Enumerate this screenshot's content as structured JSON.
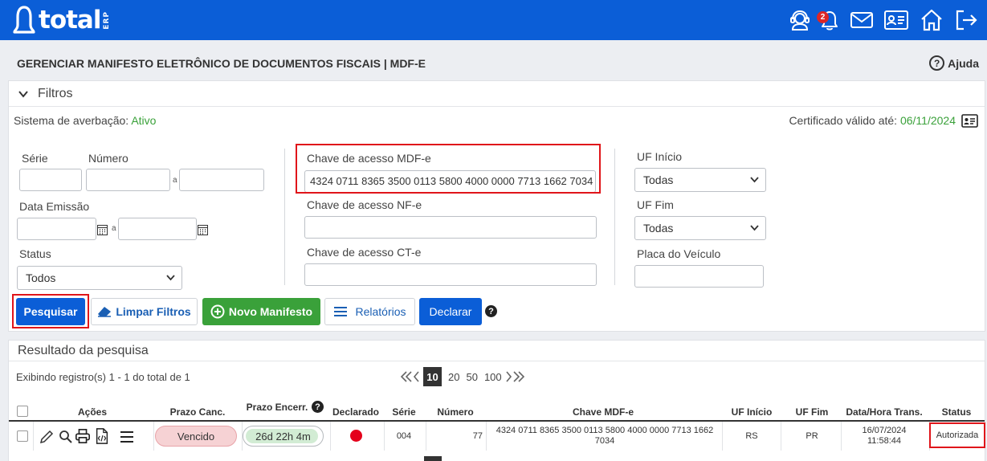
{
  "app": {
    "logo_text": "total",
    "logo_sub": "ERP",
    "notifications_count": "2",
    "page_title": "GERENCIAR MANIFESTO ELETRÔNICO DE DOCUMENTOS FISCAIS | MDF-E",
    "help_label": "Ajuda"
  },
  "filters": {
    "section_title": "Filtros",
    "averbacao_label": "Sistema de averbação:",
    "averbacao_value": "Ativo",
    "cert_label": "Certificado válido até:",
    "cert_value": "06/11/2024",
    "serie_label": "Série",
    "numero_label": "Número",
    "range_sep": "a",
    "data_emissao_label": "Data Emissão",
    "status_label": "Status",
    "status_value": "Todos",
    "chave_mdfe_label": "Chave de acesso MDF-e",
    "chave_mdfe_value": "4324 0711 8365 3500 0113 5800 4000 0000 7713 1662 7034",
    "chave_nfe_label": "Chave de acesso NF-e",
    "chave_cte_label": "Chave de acesso CT-e",
    "uf_inicio_label": "UF Início",
    "uf_inicio_value": "Todas",
    "uf_fim_label": "UF Fim",
    "uf_fim_value": "Todas",
    "placa_label": "Placa do Veículo"
  },
  "buttons": {
    "pesquisar": "Pesquisar",
    "limpar": "Limpar Filtros",
    "novo": "Novo Manifesto",
    "relatorios": "Relatórios",
    "declarar": "Declarar",
    "help_glyph": "?"
  },
  "results": {
    "title": "Resultado da pesquisa",
    "showing": "Exibindo registro(s) 1 - 1 do total de 1",
    "page_sizes": [
      "10",
      "20",
      "50",
      "100"
    ],
    "headers": {
      "acoes": "Ações",
      "prazo_canc": "Prazo Canc.",
      "prazo_encerr": "Prazo Encerr.",
      "declarado": "Declarado",
      "serie": "Série",
      "numero": "Número",
      "chave": "Chave MDF-e",
      "uf_inicio": "UF Início",
      "uf_fim": "UF Fim",
      "data_hora": "Data/Hora Trans.",
      "status": "Status"
    },
    "rows": [
      {
        "prazo_canc": "Vencido",
        "prazo_encerr": "26d 22h 4m",
        "serie": "004",
        "numero": "77",
        "chave_line1": "4324 0711 8365 3500 0113 5800 4000 0000 7713 1662",
        "chave_line2": "7034",
        "uf_inicio": "RS",
        "uf_fim": "PR",
        "data": "16/07/2024",
        "hora": "11:58:44",
        "status": "Autorizada"
      }
    ]
  },
  "colors": {
    "brand_blue": "#0b5ed7",
    "green": "#3aa13a",
    "highlight_red": "#e0151a",
    "declarado_dot": "#e4001b"
  }
}
